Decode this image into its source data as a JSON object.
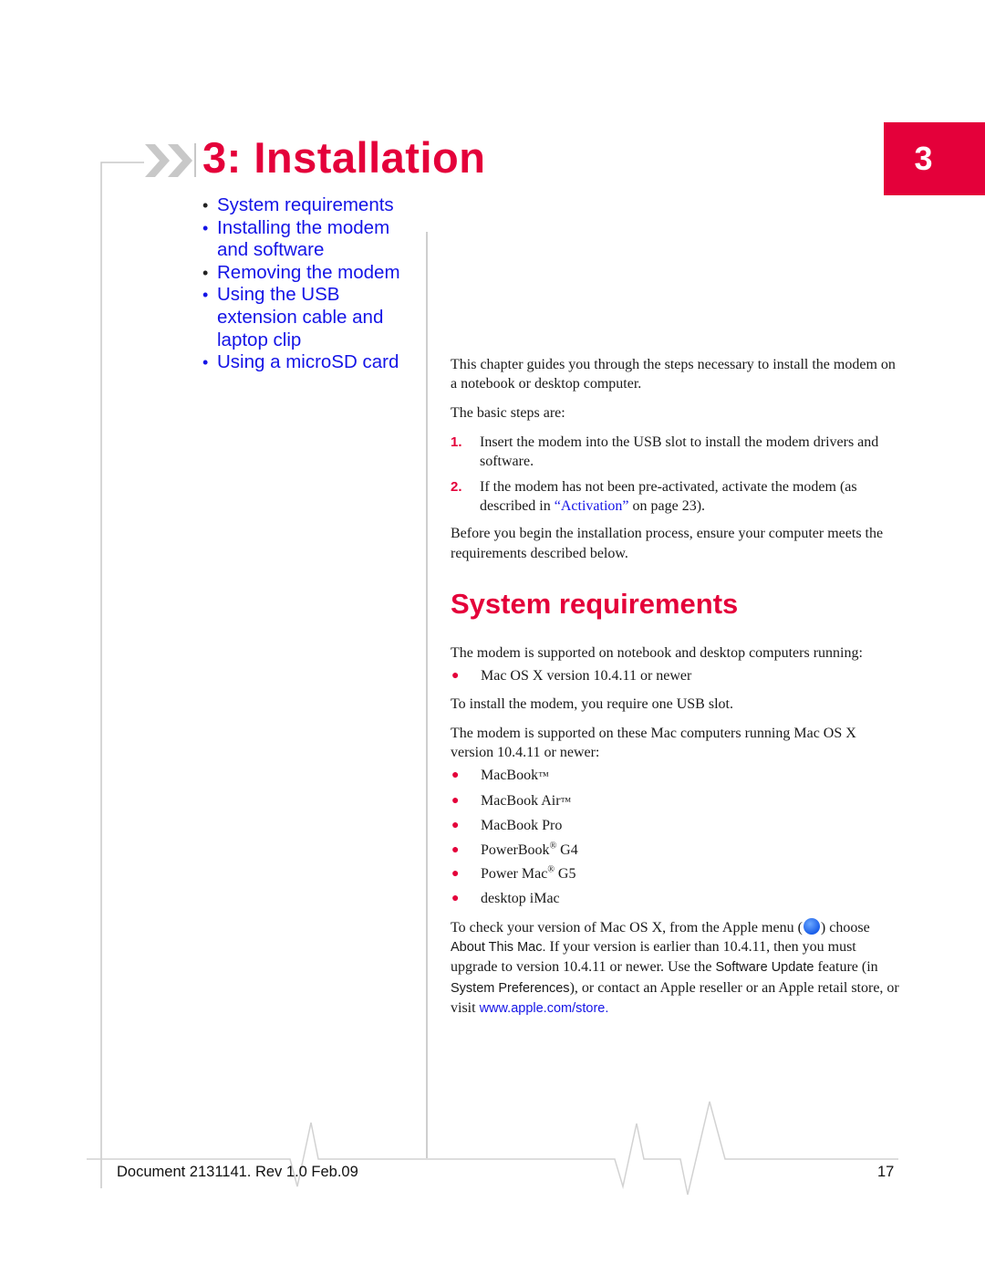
{
  "chapter": {
    "title": "3: Installation",
    "tab_number": "3",
    "accent_color": "#e4003a"
  },
  "toc": {
    "items": [
      {
        "label": "System requirements",
        "bullet": "•"
      },
      {
        "label": "Installing the modem and software",
        "bullet": "•"
      },
      {
        "label": "Removing the modem",
        "bullet": "•"
      },
      {
        "label": "Using the USB extension cable and laptop clip",
        "bullet": "•"
      },
      {
        "label": "Using a microSD card",
        "bullet": "•"
      }
    ]
  },
  "intro": {
    "paragraph1": "This chapter guides you through the steps necessary to install the modem on a notebook or desktop computer.",
    "paragraph2": "The basic steps are:",
    "steps": [
      {
        "num": "1.",
        "text": "Insert the modem into the USB slot to install the modem drivers and software."
      },
      {
        "num": "2.",
        "text_before": "If the modem has not been pre-activated, activate the modem (as described in ",
        "link": "“Activation”",
        "text_after": " on page 23)."
      }
    ],
    "paragraph3": "Before you begin the installation process, ensure your computer meets the requirements described below."
  },
  "system_requirements": {
    "heading": "System requirements",
    "paragraph1": "The modem is supported on notebook and desktop computers running:",
    "os_list": [
      "Mac OS X version 10.4.11 or newer"
    ],
    "paragraph2": "To install the modem, you require one USB slot.",
    "paragraph3": "The modem is supported on these Mac computers running Mac OS X version 10.4.11 or newer:",
    "computers": [
      {
        "name": "MacBook",
        "mark": "™",
        "suffix": ""
      },
      {
        "name": "MacBook Air",
        "mark": "™",
        "suffix": ""
      },
      {
        "name": "MacBook Pro",
        "mark": "",
        "suffix": ""
      },
      {
        "name": "PowerBook",
        "mark": "®",
        "suffix": " G4"
      },
      {
        "name": "Power Mac",
        "mark": "®",
        "suffix": " G5"
      },
      {
        "name": "desktop iMac",
        "mark": "",
        "suffix": ""
      }
    ],
    "check": {
      "t1": "To check your version of Mac OS X, from the Apple menu (",
      "icon": "apple-icon",
      "t2": ") choose ",
      "ui1": "About This Mac.",
      "t3": " If your version is earlier than 10.4.11, then you must upgrade to version 10.4.11 or newer. Use the ",
      "ui2": "Software Update",
      "t4": " feature (in ",
      "ui3": "System Preferences",
      "t5": "), or contact an Apple reseller or an Apple retail store, or visit ",
      "url": "www.apple.com/store",
      "t6": "."
    }
  },
  "footer": {
    "document": "Document 2131141. Rev 1.0  Feb.09",
    "page_number": "17"
  }
}
